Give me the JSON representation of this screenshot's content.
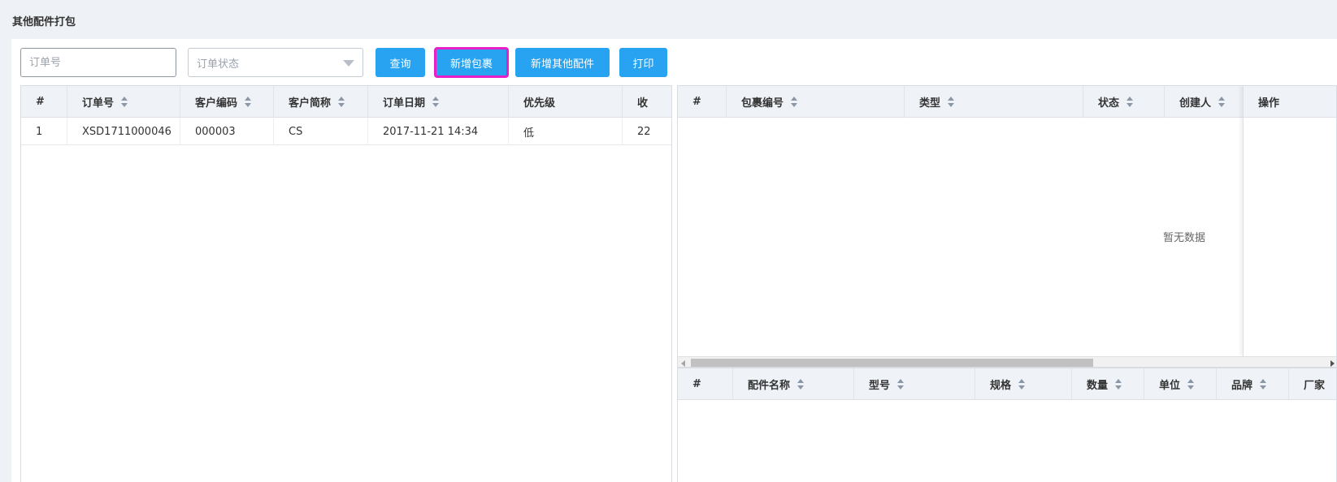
{
  "page": {
    "title": "其他配件打包"
  },
  "toolbar": {
    "order_no_placeholder": "订单号",
    "status_placeholder": "订单状态",
    "query_label": "查询",
    "add_package_label": "新增包裹",
    "add_other_label": "新增其他配件",
    "print_label": "打印"
  },
  "orders_table": {
    "columns": [
      "#",
      "订单号",
      "客户编码",
      "客户简称",
      "订单日期",
      "优先级",
      "收"
    ],
    "rows": [
      {
        "index": "1",
        "order_no": "XSD1711000046",
        "customer_code": "000003",
        "customer_short": "CS",
        "order_date": "2017-11-21 14:34",
        "priority": "低",
        "receive": "22"
      }
    ]
  },
  "packages_table": {
    "columns": [
      "#",
      "包裹编号",
      "类型",
      "状态",
      "创建人",
      "操作"
    ],
    "empty_text": "暂无数据"
  },
  "parts_table": {
    "columns": [
      "#",
      "配件名称",
      "型号",
      "规格",
      "数量",
      "单位",
      "品牌",
      "厂家"
    ]
  },
  "colors": {
    "primary": "#27a3f2",
    "highlight": "#e81ec7",
    "header_bg": "#eff2f7"
  }
}
